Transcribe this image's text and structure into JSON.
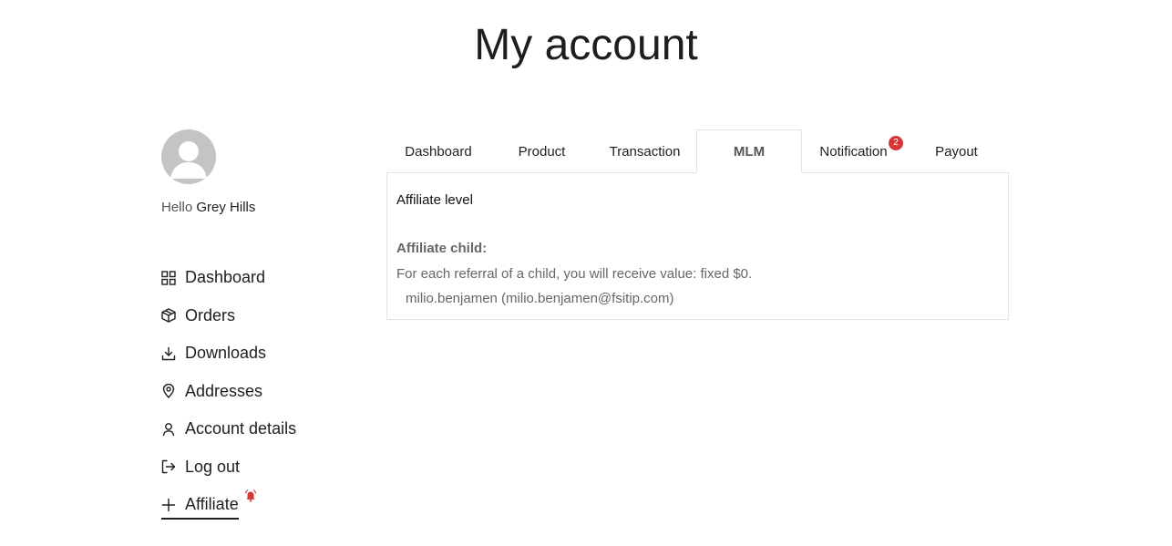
{
  "page": {
    "title": "My account"
  },
  "user": {
    "greeting_prefix": "Hello",
    "name": "Grey Hills"
  },
  "sidebar": {
    "items": [
      {
        "label": "Dashboard",
        "icon": "grid-icon"
      },
      {
        "label": "Orders",
        "icon": "package-icon"
      },
      {
        "label": "Downloads",
        "icon": "download-icon"
      },
      {
        "label": "Addresses",
        "icon": "map-pin-icon"
      },
      {
        "label": "Account details",
        "icon": "user-icon"
      },
      {
        "label": "Log out",
        "icon": "logout-icon"
      },
      {
        "label": "Affiliate",
        "icon": "plus-icon",
        "active": true,
        "alert_icon": "bell-icon"
      }
    ]
  },
  "tabs": {
    "items": [
      {
        "label": "Dashboard"
      },
      {
        "label": "Product"
      },
      {
        "label": "Transaction"
      },
      {
        "label": "MLM",
        "active": true
      },
      {
        "label": "Notification",
        "badge": "2"
      },
      {
        "label": "Payout"
      }
    ]
  },
  "mlm": {
    "level_label": "Affiliate level",
    "child_title": "Affiliate child:",
    "description": "For each referral of a child, you will receive value: fixed $0.",
    "children": [
      "milio.benjamen (milio.benjamen@fsitip.com)"
    ]
  },
  "colors": {
    "badge": "#d63638",
    "avatar": "#c4c4c4",
    "border": "#e2e2e2"
  }
}
